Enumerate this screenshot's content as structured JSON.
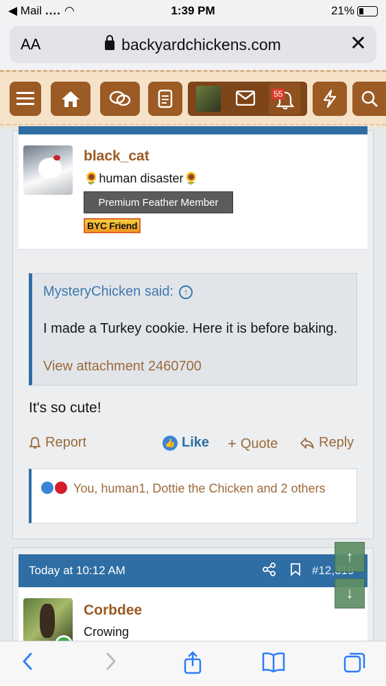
{
  "status_bar": {
    "carrier": "◀ Mail",
    "signal": "....",
    "time": "1:39 PM",
    "battery": "21%"
  },
  "browser": {
    "text_size": "AA",
    "url": "backyardchickens.com",
    "close": "✕"
  },
  "site_nav": {
    "alerts_count": "55"
  },
  "post": {
    "username": "black_cat",
    "user_title": "🌻human disaster🌻",
    "badge_member": "Premium Feather Member",
    "badge_friend": "BYC Friend",
    "quote": {
      "author": "MysteryChicken said:",
      "text": "I made a Turkey cookie. Here it is before baking.",
      "attachment": "View attachment 2460700"
    },
    "body": "It's so cute!",
    "actions": {
      "report": "Report",
      "like": "Like",
      "quote": "Quote",
      "reply": "Reply"
    },
    "reactions": "You, human1, Dottie the Chicken and 2 others"
  },
  "next_post": {
    "time": "Today at 10:12 AM",
    "post_number": "#12,319",
    "username": "Corbdee",
    "user_title": "Crowing"
  },
  "colors": {
    "accent": "#2f6ea4",
    "brand_brown": "#9c5a24",
    "link": "#9b6a3a",
    "ios_blue": "#2a7cf5"
  }
}
